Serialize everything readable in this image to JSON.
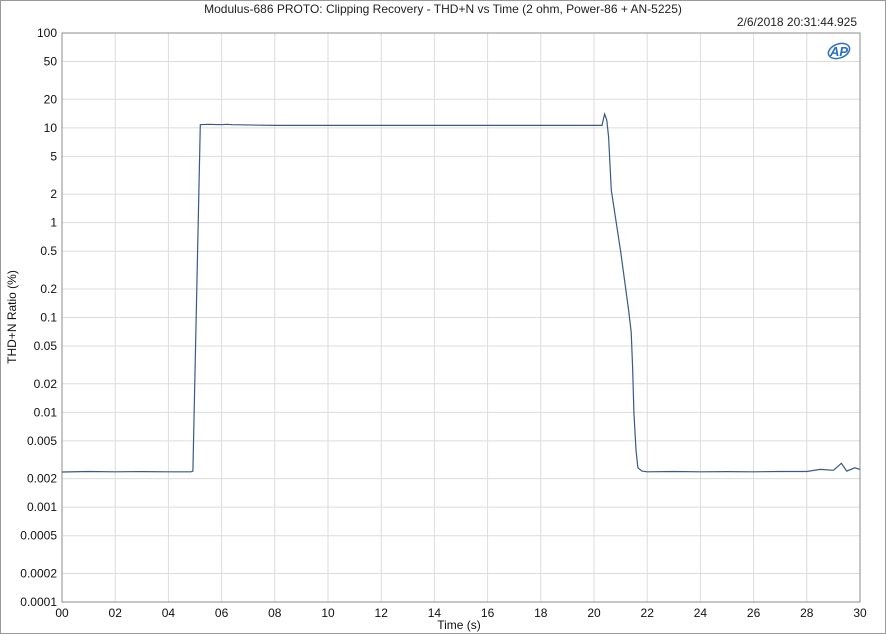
{
  "chart_data": {
    "type": "line",
    "title": "Modulus-686 PROTO: Clipping Recovery - THD+N vs Time (2 ohm, Power-86 + AN-5225)",
    "timestamp": "2/6/2018 20:31:44.925",
    "xlabel": "Time (s)",
    "ylabel": "THD+N Ratio (%)",
    "xlim": [
      0,
      30
    ],
    "ylim": [
      0.0001,
      100
    ],
    "yscale": "log",
    "grid": true,
    "x_tick_labels": [
      "00",
      "02",
      "04",
      "06",
      "08",
      "10",
      "12",
      "14",
      "16",
      "18",
      "20",
      "22",
      "24",
      "26",
      "28",
      "30"
    ],
    "y_ticks": [
      {
        "value": 100,
        "label": "100"
      },
      {
        "value": 50,
        "label": "50"
      },
      {
        "value": 20,
        "label": "20"
      },
      {
        "value": 10,
        "label": "10"
      },
      {
        "value": 5,
        "label": "5"
      },
      {
        "value": 2,
        "label": "2"
      },
      {
        "value": 1,
        "label": "1"
      },
      {
        "value": 0.5,
        "label": "0.5"
      },
      {
        "value": 0.2,
        "label": "0.2"
      },
      {
        "value": 0.1,
        "label": "0.1"
      },
      {
        "value": 0.05,
        "label": "0.05"
      },
      {
        "value": 0.02,
        "label": "0.02"
      },
      {
        "value": 0.01,
        "label": "0.01"
      },
      {
        "value": 0.005,
        "label": "0.005"
      },
      {
        "value": 0.002,
        "label": "0.002"
      },
      {
        "value": 0.001,
        "label": "0.001"
      },
      {
        "value": 0.0005,
        "label": "0.0005"
      },
      {
        "value": 0.0002,
        "label": "0.0002"
      },
      {
        "value": 0.0001,
        "label": "0.0001"
      }
    ],
    "series": [
      {
        "color": "#3a5a85",
        "points": [
          [
            0.0,
            0.00235
          ],
          [
            1.0,
            0.00238
          ],
          [
            2.0,
            0.00236
          ],
          [
            3.0,
            0.00237
          ],
          [
            4.0,
            0.00236
          ],
          [
            4.85,
            0.00236
          ],
          [
            4.92,
            0.0024
          ],
          [
            5.2,
            10.8
          ],
          [
            5.5,
            10.9
          ],
          [
            6.0,
            10.8
          ],
          [
            6.2,
            10.9
          ],
          [
            6.4,
            10.8
          ],
          [
            8.0,
            10.6
          ],
          [
            10.0,
            10.6
          ],
          [
            12.0,
            10.6
          ],
          [
            14.0,
            10.6
          ],
          [
            16.0,
            10.6
          ],
          [
            18.0,
            10.6
          ],
          [
            20.0,
            10.6
          ],
          [
            20.3,
            10.6
          ],
          [
            20.4,
            14.0
          ],
          [
            20.48,
            12.0
          ],
          [
            20.55,
            8.0
          ],
          [
            20.65,
            2.2
          ],
          [
            21.0,
            0.5
          ],
          [
            21.3,
            0.12
          ],
          [
            21.4,
            0.07
          ],
          [
            21.45,
            0.03
          ],
          [
            21.5,
            0.01
          ],
          [
            21.58,
            0.004
          ],
          [
            21.65,
            0.0026
          ],
          [
            21.8,
            0.0024
          ],
          [
            22.0,
            0.00236
          ],
          [
            23.0,
            0.00238
          ],
          [
            24.0,
            0.00236
          ],
          [
            25.0,
            0.00237
          ],
          [
            26.0,
            0.00236
          ],
          [
            27.0,
            0.00238
          ],
          [
            28.0,
            0.00238
          ],
          [
            28.5,
            0.0025
          ],
          [
            29.0,
            0.00245
          ],
          [
            29.3,
            0.0029
          ],
          [
            29.5,
            0.0024
          ],
          [
            29.8,
            0.0026
          ],
          [
            30.0,
            0.0025
          ]
        ]
      }
    ]
  },
  "logo": {
    "text": "AP",
    "icon": "ap-logo-icon"
  }
}
